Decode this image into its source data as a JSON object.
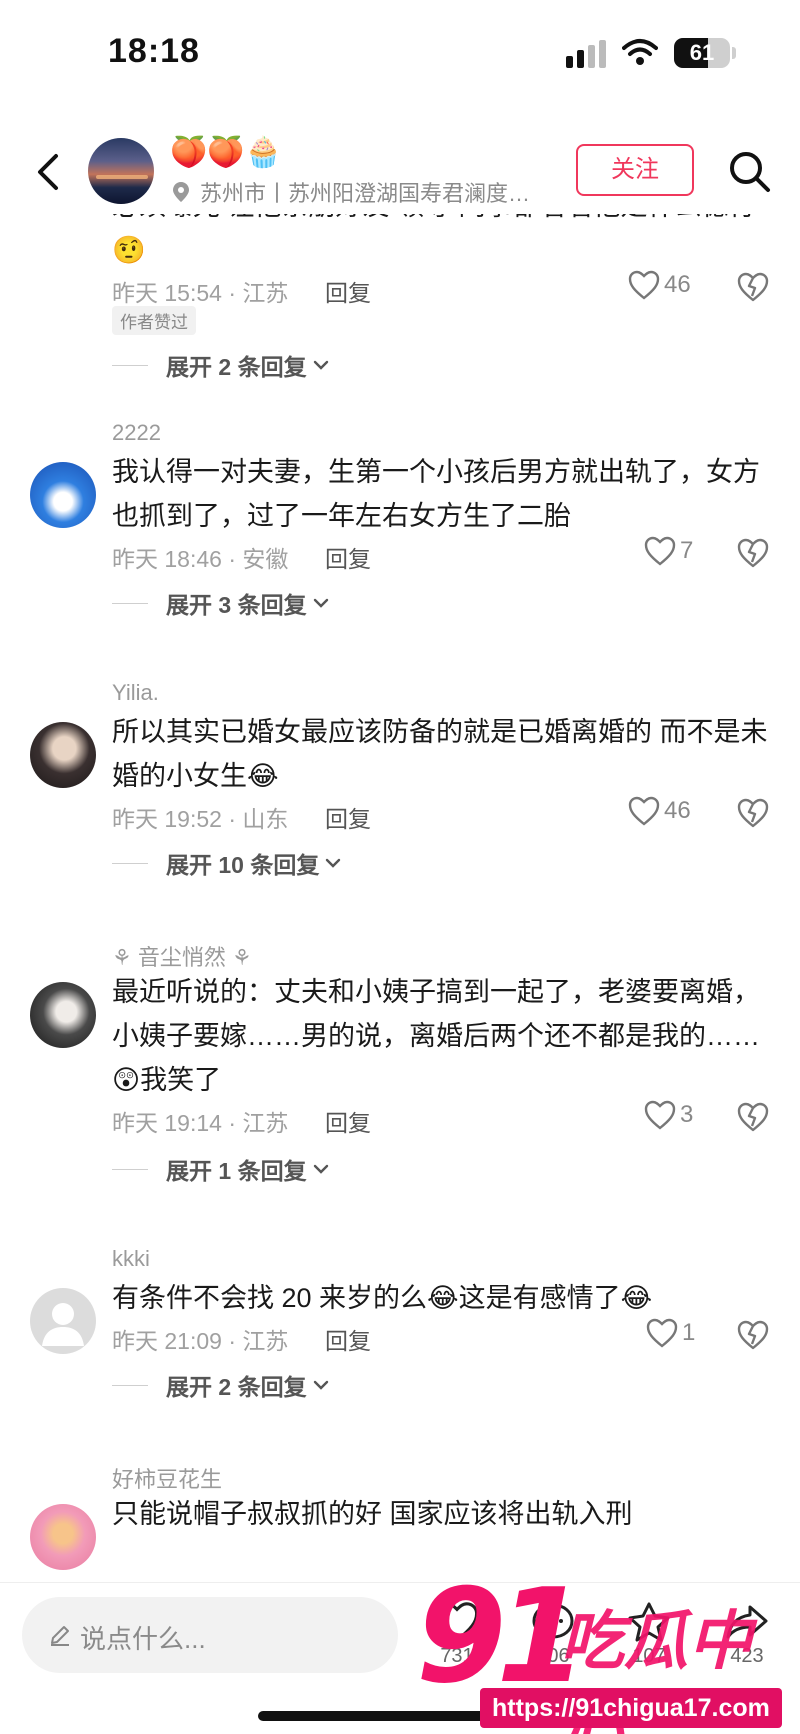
{
  "status_bar": {
    "time": "18:18",
    "battery": "61",
    "battery_level": 0.61
  },
  "header": {
    "emojis": "🍑🍑🧁",
    "location": "苏州市丨苏州阳澄湖国寿君澜度…",
    "follow_label": "关注"
  },
  "comments": [
    {
      "username": "",
      "text": "必须曝光 让他亲朋好友 领导 同事都看看他是什么德行",
      "emoji_suffix": "🤨",
      "time": "昨天 15:54 · 江苏",
      "reply_label": "回复",
      "likes": "46",
      "author_badge": "作者赞过",
      "expand": "展开 2 条回复"
    },
    {
      "username": "2222",
      "text": "我认得一对夫妻，生第一个小孩后男方就出轨了，女方也抓到了，过了一年左右女方生了二胎",
      "time": "昨天 18:46 · 安徽",
      "reply_label": "回复",
      "likes": "7",
      "expand": "展开 3 条回复"
    },
    {
      "username": "Yilia.",
      "text": "所以其实已婚女最应该防备的就是已婚离婚的 而不是未婚的小女生",
      "emoji_suffix": "😂",
      "time": "昨天 19:52 · 山东",
      "reply_label": "回复",
      "likes": "46",
      "expand": "展开 10 条回复"
    },
    {
      "username": "⚘ 音尘悄然 ⚘",
      "text_line1": "最近听说的：丈夫和小姨子搞到一起了，老婆要离婚，小姨子要嫁……男的说，离婚后两个还不都是我的……",
      "emoji_mid": "😲",
      "text_after": "我笑了",
      "time": "昨天 19:14 · 江苏",
      "reply_label": "回复",
      "likes": "3",
      "expand": "展开 1 条回复"
    },
    {
      "username": "kkki",
      "text_a": "有条件不会找 20 来岁的么",
      "emoji_a": "😂",
      "text_b": "这是有感情了",
      "emoji_b": "😂",
      "time": "昨天 21:09 · 江苏",
      "reply_label": "回复",
      "likes": "1",
      "expand": "展开 2 条回复"
    },
    {
      "username": "好柿豆花生",
      "text": "只能说帽子叔叔抓的好 国家应该将出轨入刑"
    }
  ],
  "bottom_bar": {
    "placeholder": "说点什么...",
    "likes": "731",
    "comments": "206",
    "favorites": "107",
    "shares": "423"
  },
  "watermark": {
    "number": "91",
    "name": "吃瓜中心",
    "url": "https://91chigua17.com"
  },
  "colors": {
    "accent": "#f0375c",
    "watermark": "#f2136a"
  }
}
